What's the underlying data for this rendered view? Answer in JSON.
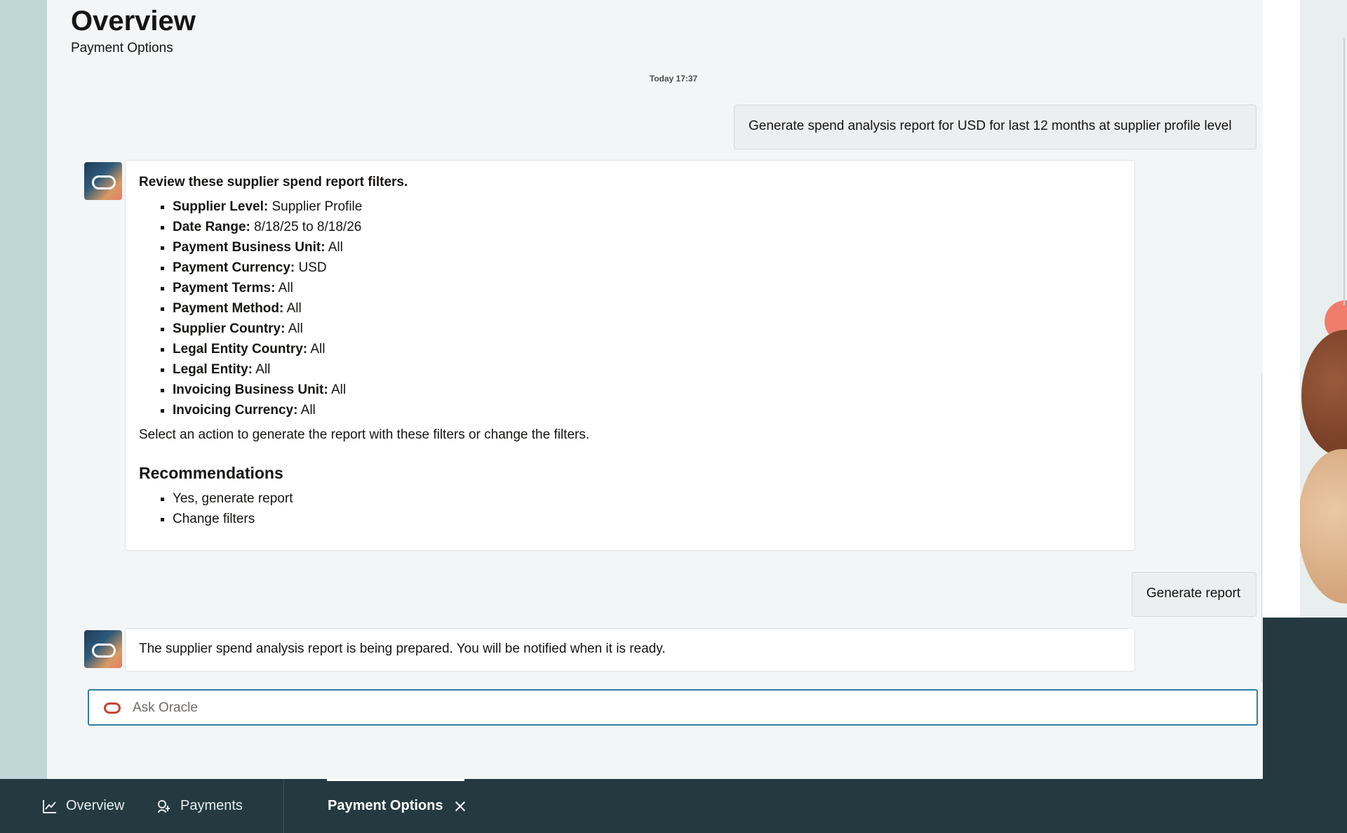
{
  "page": {
    "title": "Overview",
    "subtitle": "Payment Options"
  },
  "conversation": {
    "timestamp": "Today 17:37",
    "user_message_1": "Generate spend analysis report for USD for last 12 months at supplier profile level",
    "bot_message_1": {
      "heading": "Review these supplier spend report filters.",
      "filters": [
        {
          "label": "Supplier Level:",
          "value": "Supplier Profile"
        },
        {
          "label": "Date Range:",
          "value": "8/18/25 to 8/18/26"
        },
        {
          "label": "Payment Business Unit:",
          "value": "All"
        },
        {
          "label": "Payment Currency:",
          "value": "USD"
        },
        {
          "label": "Payment Terms:",
          "value": "All"
        },
        {
          "label": "Payment Method:",
          "value": "All"
        },
        {
          "label": "Supplier Country:",
          "value": "All"
        },
        {
          "label": "Legal Entity Country:",
          "value": "All"
        },
        {
          "label": "Legal Entity:",
          "value": "All"
        },
        {
          "label": "Invoicing Business Unit:",
          "value": "All"
        },
        {
          "label": "Invoicing Currency:",
          "value": "All"
        }
      ],
      "note": "Select an action to generate the report with these filters or change the filters.",
      "recommendations_title": "Recommendations",
      "recommendations": [
        "Yes, generate report",
        "Change filters"
      ]
    },
    "user_message_2": "Generate report",
    "bot_message_2": "The supplier spend analysis report is being prepared. You will be notified when it is ready."
  },
  "ask": {
    "placeholder": "Ask Oracle",
    "value": ""
  },
  "bottom_tabs": {
    "overview": "Overview",
    "payments": "Payments",
    "payment_options": "Payment Options"
  },
  "colors": {
    "accent_border": "#2f7ea3",
    "oracle_red": "#c74634",
    "bottom_bar": "#243a40"
  }
}
